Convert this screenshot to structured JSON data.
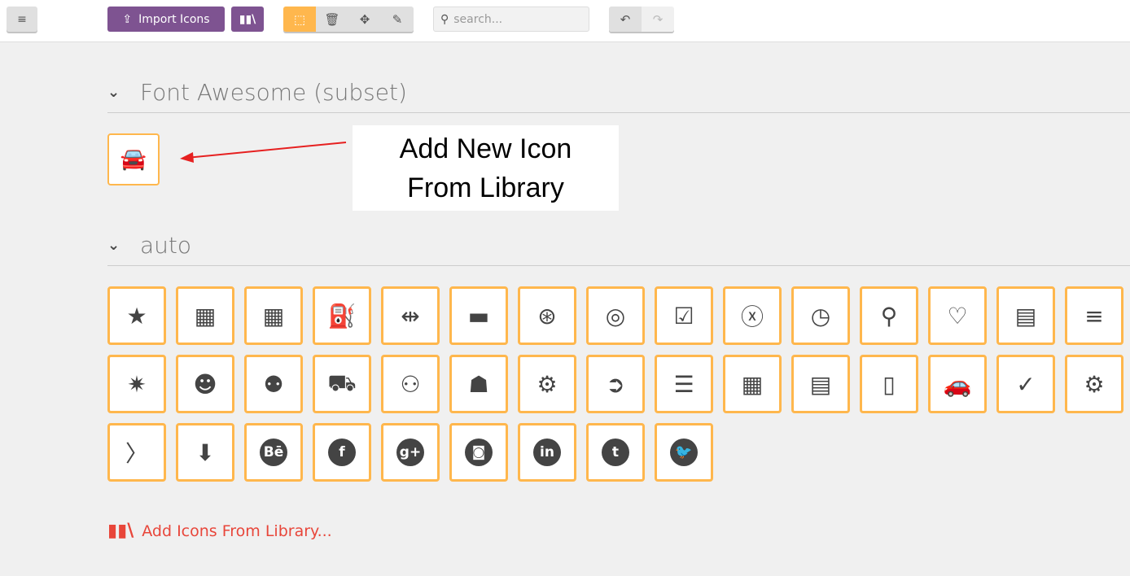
{
  "toolbar": {
    "menu_icon": "hamburger-icon",
    "import_label": "Import Icons",
    "import_icon": "upload-icon",
    "library_icon": "books-icon",
    "modes": [
      {
        "icon": "select-cursor-icon",
        "active": true
      },
      {
        "icon": "trash-icon",
        "active": false
      },
      {
        "icon": "move-icon",
        "active": false
      },
      {
        "icon": "pencil-icon",
        "active": false
      }
    ],
    "search_placeholder": "search...",
    "undo_icon": "undo-icon",
    "redo_icon": "redo-icon"
  },
  "sections": [
    {
      "title": "Font Awesome (subset)",
      "icons": [
        "car"
      ]
    },
    {
      "title": "auto",
      "icons": [
        "star",
        "calendar",
        "calendar-edit",
        "oil-can",
        "tire-alignment",
        "battery",
        "wheel",
        "brake-disc",
        "checklist-document",
        "close-circle",
        "clock",
        "map-marker",
        "heart",
        "comment",
        "bars",
        "party-popper",
        "mechanic",
        "team",
        "car-front",
        "users",
        "user-suit",
        "gear",
        "arrow-circle-right",
        "align-left",
        "calculator",
        "clipboard",
        "certificate-document",
        "car-side",
        "check",
        "gear-check",
        "chevron-right",
        "arrow-down",
        "behance",
        "facebook",
        "google-plus",
        "instagram",
        "linkedin",
        "tumblr",
        "twitter"
      ]
    }
  ],
  "callout": {
    "line1": "Add New Icon",
    "line2": "From Library"
  },
  "add_from_library": "Add Icons From Library...",
  "colors": {
    "accent": "#ffb74d",
    "purple": "#7e5391",
    "link": "#e8463a",
    "annotation_arrow": "#e62020"
  }
}
